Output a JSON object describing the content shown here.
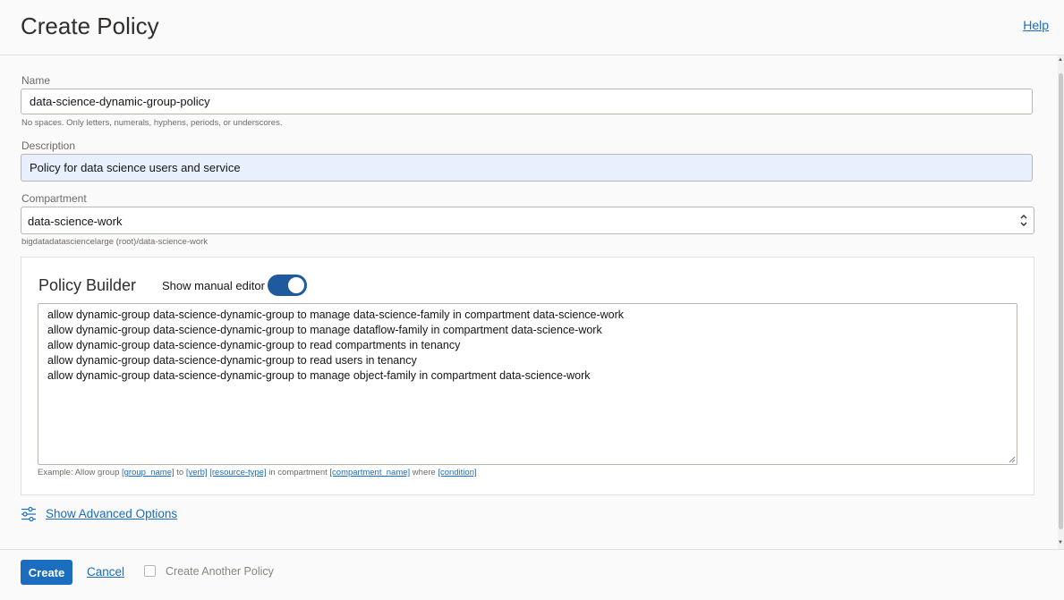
{
  "header": {
    "title": "Create Policy",
    "help_label": "Help"
  },
  "form": {
    "name": {
      "label": "Name",
      "value": "data-science-dynamic-group-policy",
      "hint": "No spaces. Only letters, numerals, hyphens, periods, or underscores."
    },
    "description": {
      "label": "Description",
      "value": "Policy for data science users and service"
    },
    "compartment": {
      "label": "Compartment",
      "value": "data-science-work",
      "path": "bigdatadatasciencelarge (root)/data-science-work"
    }
  },
  "policy_builder": {
    "title": "Policy Builder",
    "toggle_label": "Show manual editor",
    "toggle_on": true,
    "statements": [
      "allow dynamic-group data-science-dynamic-group to manage data-science-family in compartment data-science-work",
      "allow dynamic-group data-science-dynamic-group to manage dataflow-family in compartment data-science-work",
      "allow dynamic-group data-science-dynamic-group to read compartments in tenancy",
      "allow dynamic-group data-science-dynamic-group to read users in tenancy",
      "allow dynamic-group data-science-dynamic-group to manage object-family in compartment data-science-work"
    ],
    "example": {
      "prefix": "Example: Allow group",
      "group_token": "[group_name]",
      "to_text": "to",
      "verb_token": "[verb]",
      "resource_token": "[resource-type]",
      "in_text": "in compartment",
      "compartment_token": "[compartment_name]",
      "where_text": "where",
      "condition_token": "[condition]"
    }
  },
  "advanced": {
    "label": "Show Advanced Options"
  },
  "footer": {
    "create_label": "Create",
    "cancel_label": "Cancel",
    "create_another_label": "Create Another Policy",
    "create_another_checked": false
  },
  "colors": {
    "accent": "#1a6dbf",
    "toggle": "#1f5a9e",
    "autofill": "#e8f0fe"
  }
}
